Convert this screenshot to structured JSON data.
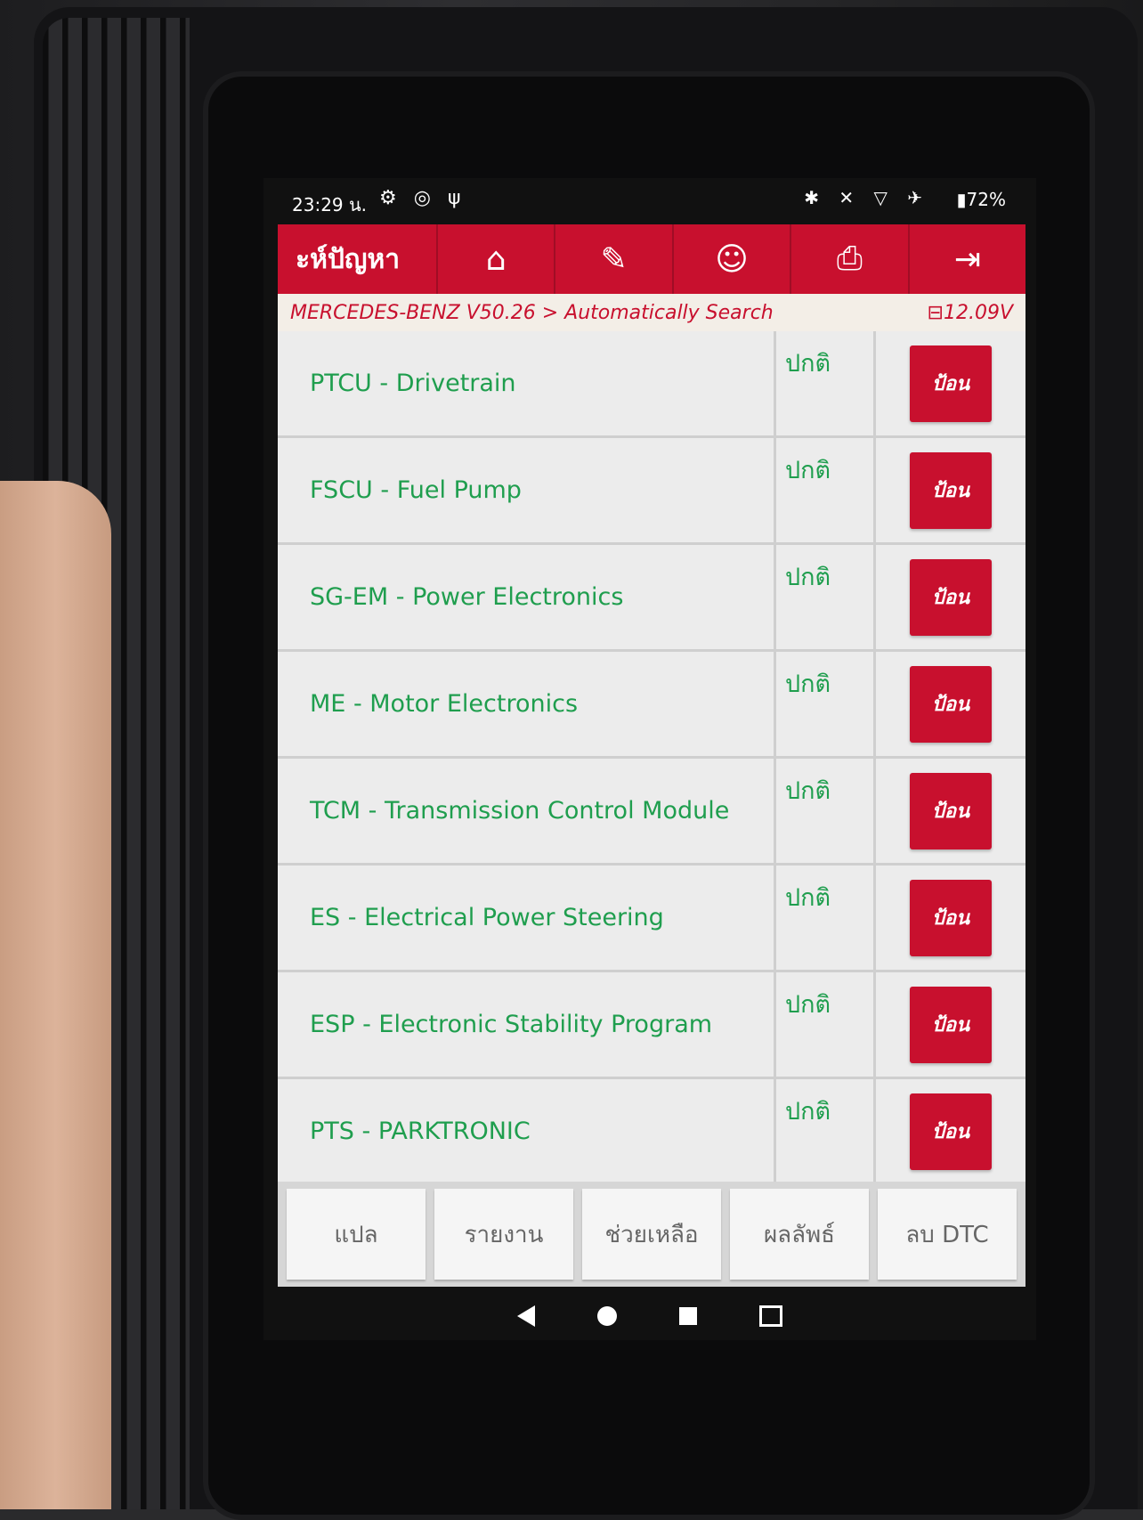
{
  "status": {
    "time": "23:29 น.",
    "icons_left": [
      "settings-icon",
      "bluetooth-diag-icon",
      "stethoscope-icon"
    ],
    "icons_right": [
      "bluetooth-icon",
      "mute-icon",
      "signal-icon",
      "airplane-icon"
    ],
    "battery": "72%"
  },
  "toolbar": {
    "title": "ะห์ปัญหา",
    "buttons": [
      "home-icon",
      "edit-icon",
      "support-icon",
      "print-icon",
      "exit-icon"
    ]
  },
  "breadcrumb": {
    "path": "MERCEDES-BENZ V50.26 > Automatically Search",
    "voltage": "12.09V"
  },
  "modules": [
    {
      "name": "PTCU - Drivetrain",
      "status": "ปกติ",
      "action": "ป้อน"
    },
    {
      "name": "FSCU - Fuel Pump",
      "status": "ปกติ",
      "action": "ป้อน"
    },
    {
      "name": "SG-EM - Power Electronics",
      "status": "ปกติ",
      "action": "ป้อน"
    },
    {
      "name": "ME - Motor Electronics",
      "status": "ปกติ",
      "action": "ป้อน"
    },
    {
      "name": "TCM - Transmission Control Module",
      "status": "ปกติ",
      "action": "ป้อน"
    },
    {
      "name": "ES - Electrical Power Steering",
      "status": "ปกติ",
      "action": "ป้อน"
    },
    {
      "name": "ESP - Electronic Stability Program",
      "status": "ปกติ",
      "action": "ป้อน"
    },
    {
      "name": "PTS - PARKTRONIC",
      "status": "ปกติ",
      "action": "ป้อน"
    }
  ],
  "bottom_buttons": [
    "แปล",
    "รายงาน",
    "ช่วยเหลือ",
    "ผลลัพธ์",
    "ลบ DTC"
  ],
  "colors": {
    "accent": "#c8102e",
    "ok_text": "#1f9e4e"
  }
}
